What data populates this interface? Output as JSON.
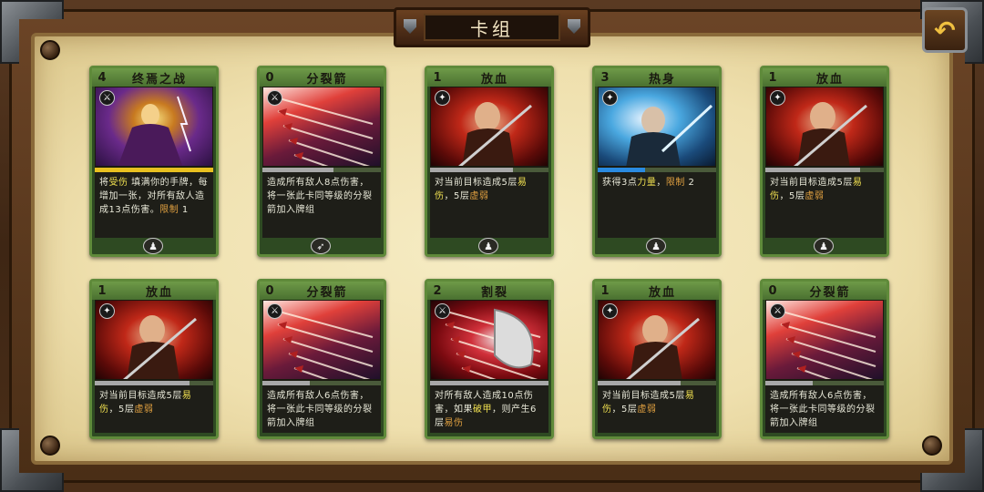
{
  "screen": {
    "title": "卡组",
    "back_label": "↶"
  },
  "colors": {
    "card_border": "#5f8a3a",
    "keyword": "#f0e050",
    "card_header": "#6e9a48"
  },
  "cards": [
    {
      "cost": "4",
      "name": "终焉之战",
      "art": "mage",
      "type_icon": "sword-icon",
      "progress": 1.0,
      "fill_color": "#e8c020",
      "desc_parts": [
        "将",
        "受伤",
        " 填满你的手牌，每增加一张，对所有敌人造成13点伤害。",
        "限制",
        " 1"
      ],
      "foot_icon": "pawn-icon"
    },
    {
      "cost": "0",
      "name": "分裂箭",
      "art": "arrows",
      "type_icon": "sword-icon",
      "progress": 0.6,
      "fill_color": "#a8a8a8",
      "desc_parts": [
        "造成所有敌人8点伤害，将一张此卡同等级的分裂箭加入牌组",
        "",
        "",
        "",
        ""
      ],
      "foot_icon": "bow-icon"
    },
    {
      "cost": "1",
      "name": "放血",
      "art": "bleed",
      "type_icon": "star-icon",
      "progress": 0.7,
      "fill_color": "#a8a8a8",
      "desc_parts": [
        "对当前目标造成5层",
        "易伤",
        "，5层",
        "虚弱",
        ""
      ],
      "foot_icon": "pawn-icon"
    },
    {
      "cost": "3",
      "name": "热身",
      "art": "ice",
      "type_icon": "star-icon",
      "progress": 0.4,
      "fill_color": "#2a8ae0",
      "desc_parts": [
        "获得3点",
        "力量",
        "，",
        "限制",
        " 2"
      ],
      "foot_icon": "pawn-icon"
    },
    {
      "cost": "1",
      "name": "放血",
      "art": "bleed",
      "type_icon": "star-icon",
      "progress": 0.8,
      "fill_color": "#a8a8a8",
      "desc_parts": [
        "对当前目标造成5层",
        "易伤",
        "，5层",
        "虚弱",
        ""
      ],
      "foot_icon": "pawn-icon"
    },
    {
      "cost": "1",
      "name": "放血",
      "art": "bleed",
      "type_icon": "star-icon",
      "progress": 0.8,
      "fill_color": "#a8a8a8",
      "desc_parts": [
        "对当前目标造成5层",
        "易伤",
        "，5层",
        "虚弱",
        ""
      ],
      "foot_icon": ""
    },
    {
      "cost": "0",
      "name": "分裂箭",
      "art": "arrows",
      "type_icon": "sword-icon",
      "progress": 0.4,
      "fill_color": "#a8a8a8",
      "desc_parts": [
        "造成所有敌人6点伤害，将一张此卡同等级的分裂箭加入牌组",
        "",
        "",
        "",
        ""
      ],
      "foot_icon": ""
    },
    {
      "cost": "2",
      "name": "割裂",
      "art": "axe",
      "type_icon": "sword-icon",
      "progress": 1.0,
      "fill_color": "#a8a8a8",
      "desc_parts": [
        "对所有敌人造成10点伤害，如果",
        "破甲",
        "，则产生6层",
        "易伤",
        ""
      ],
      "foot_icon": ""
    },
    {
      "cost": "1",
      "name": "放血",
      "art": "bleed",
      "type_icon": "star-icon",
      "progress": 0.7,
      "fill_color": "#a8a8a8",
      "desc_parts": [
        "对当前目标造成5层",
        "易伤",
        "，5层",
        "虚弱",
        ""
      ],
      "foot_icon": ""
    },
    {
      "cost": "0",
      "name": "分裂箭",
      "art": "arrows",
      "type_icon": "sword-icon",
      "progress": 0.4,
      "fill_color": "#a8a8a8",
      "desc_parts": [
        "造成所有敌人6点伤害，将一张此卡同等级的分裂箭加入牌组",
        "",
        "",
        "",
        ""
      ],
      "foot_icon": ""
    }
  ]
}
